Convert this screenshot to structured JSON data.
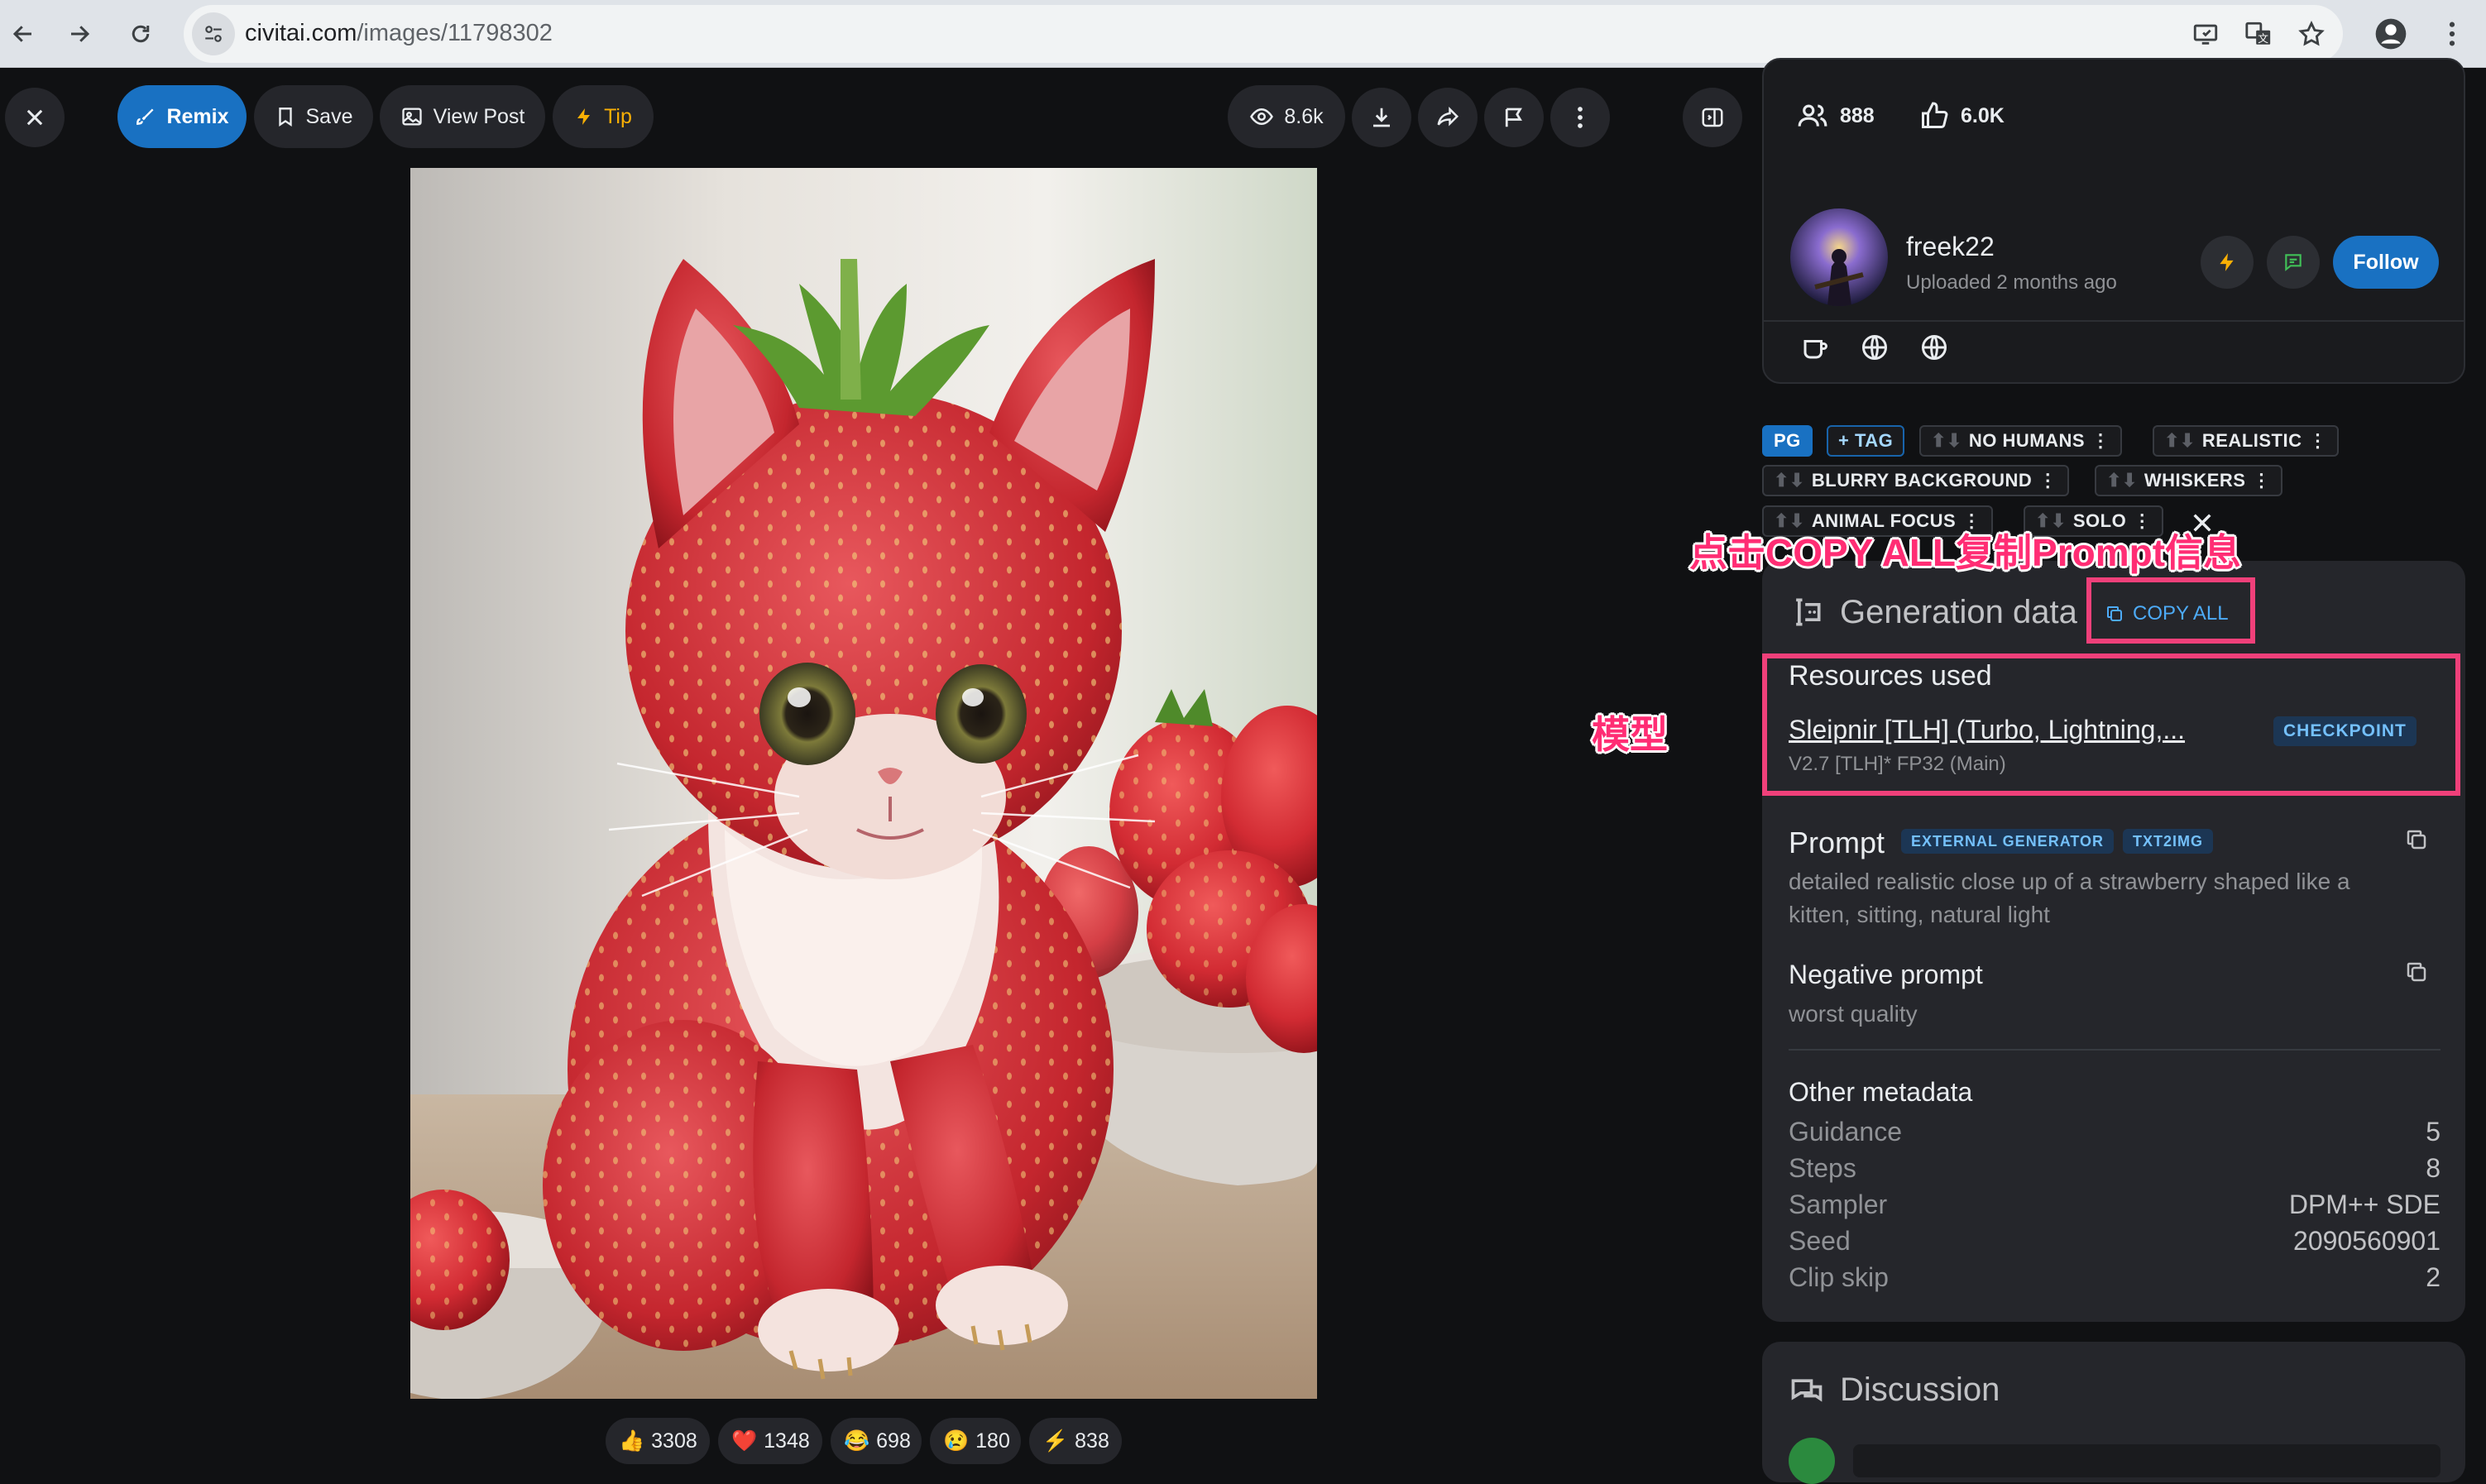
{
  "browser": {
    "url_host": "civitai.com",
    "url_path": "/images/11798302"
  },
  "toolbar": {
    "remix": "Remix",
    "save": "Save",
    "view_post": "View Post",
    "tip": "Tip",
    "views": "8.6k"
  },
  "reactions": [
    {
      "emoji": "👍",
      "count": "3308"
    },
    {
      "emoji": "❤️",
      "count": "1348"
    },
    {
      "emoji": "😂",
      "count": "698"
    },
    {
      "emoji": "😢",
      "count": "180"
    },
    {
      "emoji": "⚡",
      "count": "838"
    }
  ],
  "creator_stats": {
    "followers": "888",
    "likes": "6.0K"
  },
  "creator": {
    "name": "freek22",
    "uploaded": "Uploaded 2 months ago",
    "follow": "Follow"
  },
  "tags": {
    "pg": "PG",
    "add_tag": "+ TAG",
    "items": [
      "NO HUMANS",
      "REALISTIC",
      "BLURRY BACKGROUND",
      "WHISKERS",
      "ANIMAL FOCUS",
      "SOLO"
    ]
  },
  "generation": {
    "title": "Generation data",
    "copy_all": "COPY ALL",
    "resources_title": "Resources used",
    "resource_name": "Sleipnir [TLH] (Turbo, Lightning,...",
    "resource_version": "V2.7 [TLH]* FP32 (Main)",
    "resource_type": "CHECKPOINT",
    "prompt_title": "Prompt",
    "prompt_badges": [
      "EXTERNAL GENERATOR",
      "TXT2IMG"
    ],
    "prompt_line1": "detailed realistic close up of a strawberry shaped like a",
    "prompt_line2": "kitten, sitting, natural light",
    "negative_title": "Negative prompt",
    "negative_text": "worst quality",
    "other_title": "Other metadata",
    "meta": [
      {
        "label": "Guidance",
        "value": "5"
      },
      {
        "label": "Steps",
        "value": "8"
      },
      {
        "label": "Sampler",
        "value": "DPM++ SDE"
      },
      {
        "label": "Seed",
        "value": "2090560901"
      },
      {
        "label": "Clip skip",
        "value": "2"
      }
    ]
  },
  "discussion": {
    "title": "Discussion"
  },
  "annotations": {
    "copy_all_note": "点击COPY ALL复制Prompt信息",
    "model_note": "模型"
  },
  "colors": {
    "accent": "#1971c2",
    "annotation": "#f0407a"
  }
}
